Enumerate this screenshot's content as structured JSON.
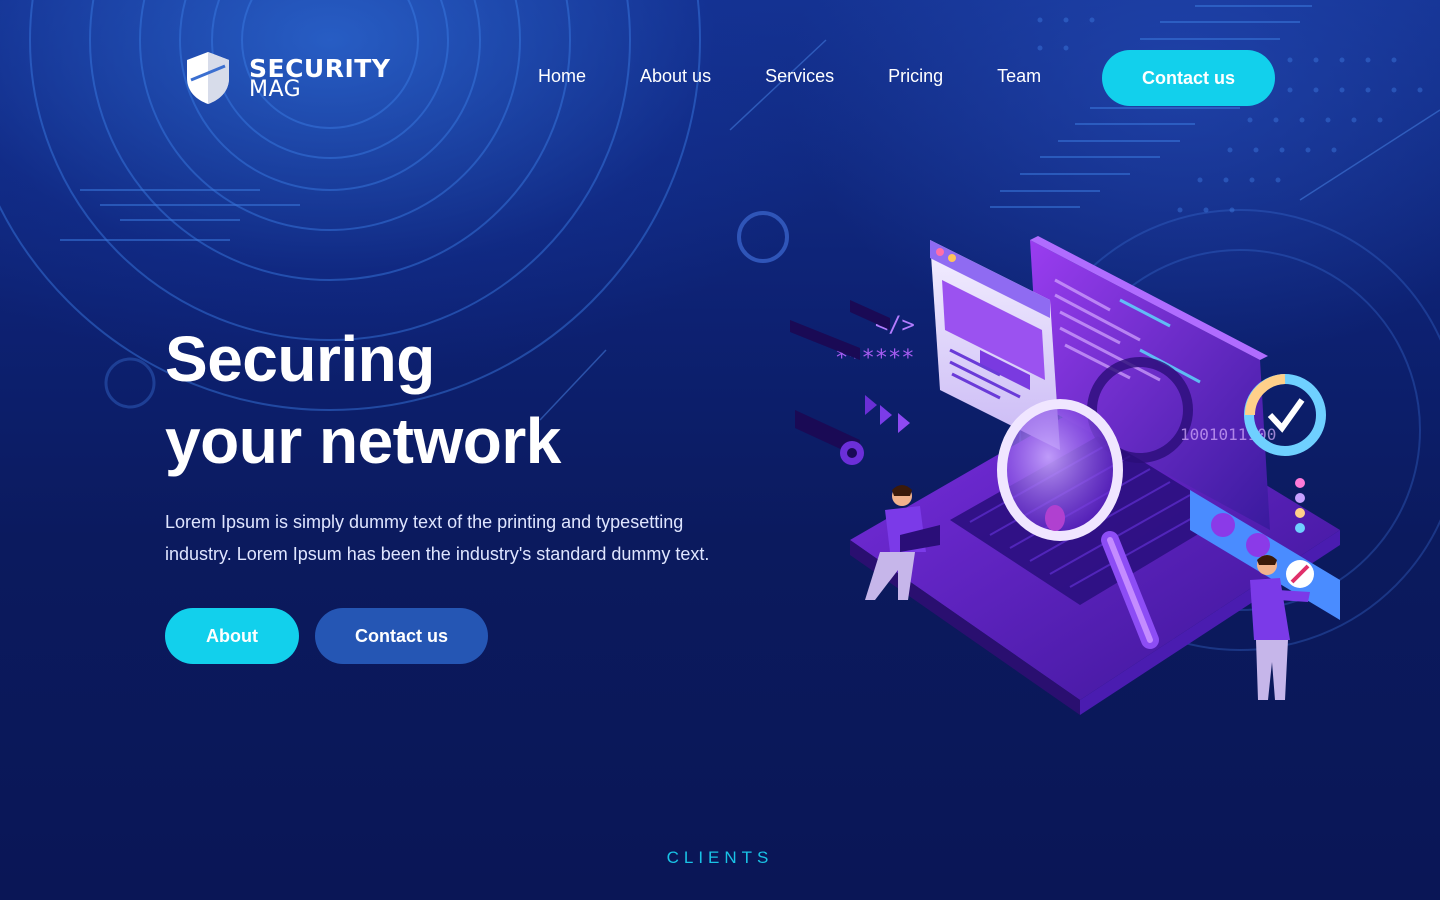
{
  "brand": {
    "name_line1": "SECURITY",
    "name_line2": "MAG"
  },
  "nav": {
    "items": [
      {
        "label": "Home"
      },
      {
        "label": "About us"
      },
      {
        "label": "Services"
      },
      {
        "label": "Pricing"
      },
      {
        "label": "Team"
      }
    ],
    "cta_label": "Contact us"
  },
  "hero": {
    "title_line1": "Securing",
    "title_line2": "your network",
    "description": "Lorem Ipsum is simply dummy text of the printing and typesetting industry. Lorem Ipsum has been the industry's standard dummy text.",
    "primary_button": "About",
    "secondary_button": "Contact us"
  },
  "illustration": {
    "code_symbol": "</>",
    "password_mask": "******",
    "binary_text": "1001011100"
  },
  "clients": {
    "label": "CLIENTS",
    "heading": ""
  },
  "colors": {
    "accent": "#12d0ec",
    "secondary_button": "#2556b4",
    "background": "#0b1a5e",
    "illustration_purple": "#7b2fe0"
  }
}
